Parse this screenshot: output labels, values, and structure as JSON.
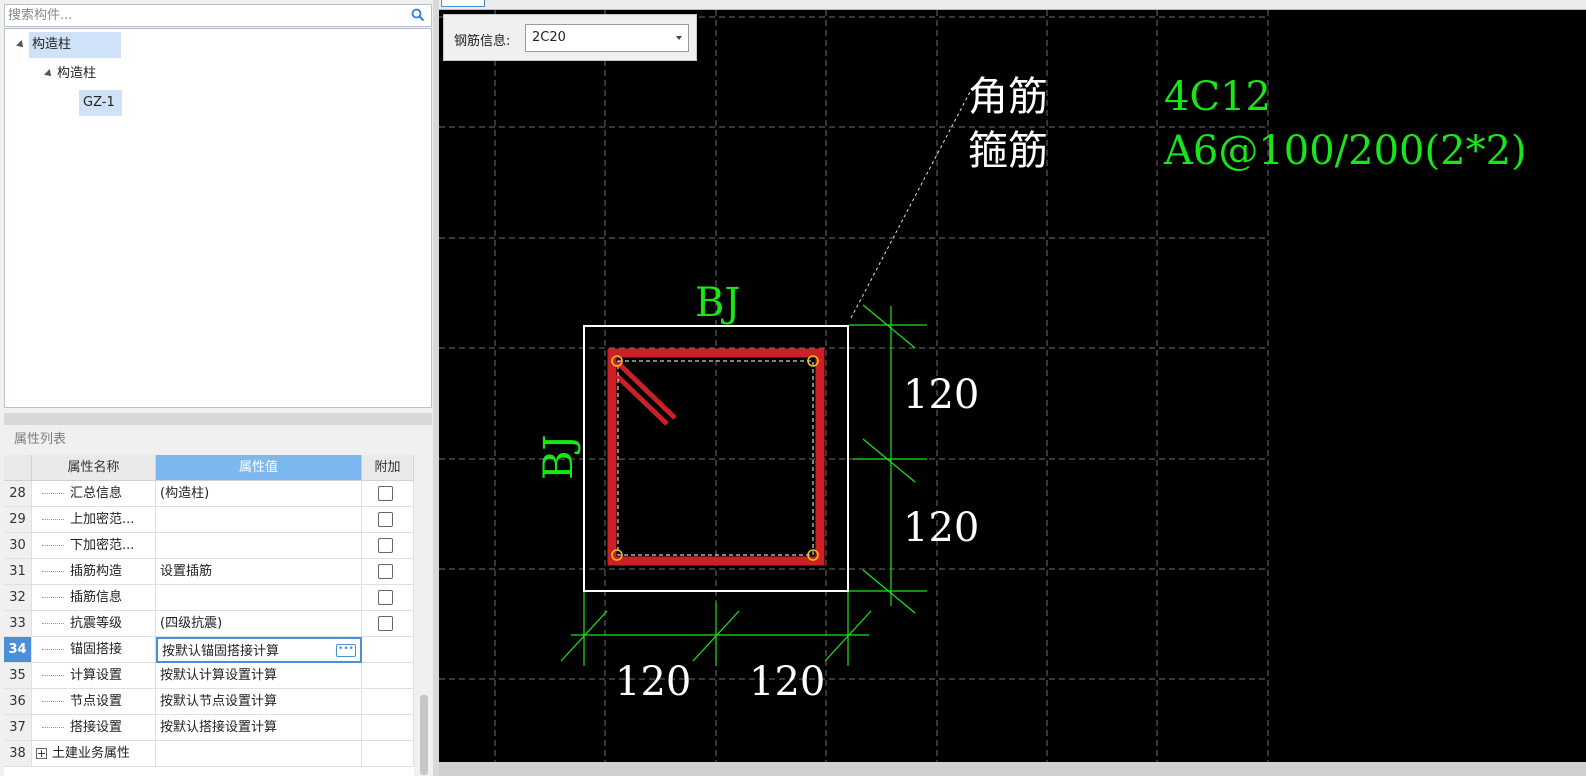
{
  "search": {
    "placeholder": "搜索构件..."
  },
  "tree": {
    "root": "构造柱",
    "child": "构造柱",
    "leaf": "GZ-1"
  },
  "properties": {
    "title": "属性列表",
    "headers": {
      "num": "",
      "name": "属性名称",
      "value": "属性值",
      "add": "附加"
    },
    "rows": [
      {
        "num": "28",
        "name": "汇总信息",
        "value": "(构造柱)",
        "check": true
      },
      {
        "num": "29",
        "name": "上加密范...",
        "value": "",
        "check": true
      },
      {
        "num": "30",
        "name": "下加密范...",
        "value": "",
        "check": true
      },
      {
        "num": "31",
        "name": "插筋构造",
        "value": "设置插筋",
        "check": true
      },
      {
        "num": "32",
        "name": "插筋信息",
        "value": "",
        "check": true
      },
      {
        "num": "33",
        "name": "抗震等级",
        "value": "(四级抗震)",
        "check": true
      },
      {
        "num": "34",
        "name": "锚固搭接",
        "value": "按默认锚固搭接计算",
        "check": false,
        "current": true
      },
      {
        "num": "35",
        "name": "计算设置",
        "value": "按默认计算设置计算",
        "check": false
      },
      {
        "num": "36",
        "name": "节点设置",
        "value": "按默认节点设置计算",
        "check": false
      },
      {
        "num": "37",
        "name": "搭接设置",
        "value": "按默认搭接设置计算",
        "check": false
      },
      {
        "num": "38",
        "name": "土建业务属性",
        "value": "",
        "check": false,
        "group": true
      }
    ]
  },
  "rebar_info": {
    "label": "钢筋信息:",
    "value": "2C20"
  },
  "drawing": {
    "corner_label": "角筋",
    "corner_value": "4C12",
    "stirrup_label": "箍筋",
    "stirrup_value": "A6@100/200(2*2)",
    "edge_top": "BJ",
    "edge_left": "BJ",
    "dim_right_1": "120",
    "dim_right_2": "120",
    "dim_bottom_1": "120",
    "dim_bottom_2": "120"
  },
  "colors": {
    "rebar": "#cc1f26",
    "annotation": "#19e619",
    "accent": "#4a90d9"
  }
}
